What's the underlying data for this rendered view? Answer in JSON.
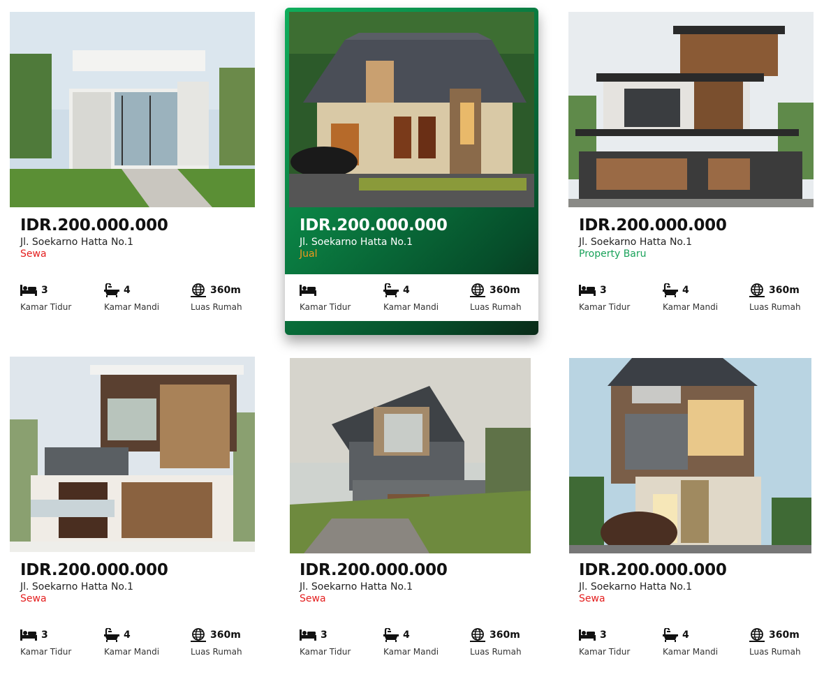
{
  "colors": {
    "sewa": "#e41e1e",
    "jual": "#f29a1d",
    "baru": "#19a25a",
    "accent": "#0a7a40"
  },
  "listings": [
    {
      "price": "IDR.200.000.000",
      "address": "Jl. Soekarno Hatta No.1",
      "tag": "Sewa",
      "features": {
        "bed": "3",
        "bath": "4",
        "area": "360m"
      }
    },
    {
      "price": "IDR.200.000.000",
      "address": "Jl. Soekarno Hatta No.1",
      "tag": "Jual",
      "features": {
        "bed": "",
        "bath": "4",
        "area": "360m"
      }
    },
    {
      "price": "IDR.200.000.000",
      "address": "Jl. Soekarno Hatta No.1",
      "tag": "Property Baru",
      "features": {
        "bed": "3",
        "bath": "4",
        "area": "360m"
      }
    },
    {
      "price": "IDR.200.000.000",
      "address": "Jl. Soekarno Hatta No.1",
      "tag": "Sewa",
      "features": {
        "bed": "3",
        "bath": "4",
        "area": "360m"
      }
    },
    {
      "price": "IDR.200.000.000",
      "address": "Jl. Soekarno Hatta No.1",
      "tag": "Sewa",
      "features": {
        "bed": "3",
        "bath": "4",
        "area": "360m"
      }
    },
    {
      "price": "IDR.200.000.000",
      "address": "Jl. Soekarno Hatta No.1",
      "tag": "Sewa",
      "features": {
        "bed": "3",
        "bath": "4",
        "area": "360m"
      }
    }
  ],
  "labels": {
    "bed": "Kamar Tidur",
    "bath": "Kamar Mandi",
    "area": "Luas Rumah"
  },
  "icons": {
    "bed": "bed-icon",
    "bath": "bathtub-icon",
    "area": "globe-icon"
  }
}
